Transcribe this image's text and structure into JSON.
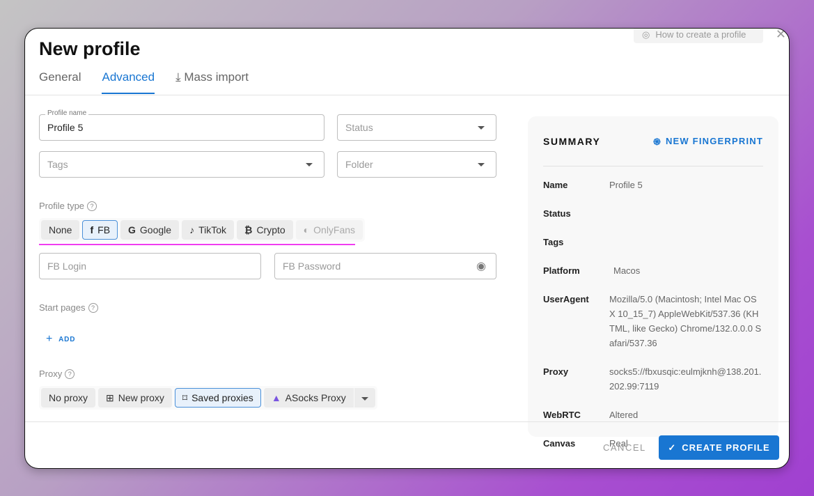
{
  "title": "New profile",
  "help_link": "How to create a profile",
  "tabs": [
    "General",
    "Advanced",
    "Mass import"
  ],
  "fields": {
    "profile_name_label": "Profile name",
    "profile_name": "Profile 5",
    "status": "Status",
    "tags": "Tags",
    "folder": "Folder",
    "fb_login": "FB Login",
    "fb_password": "FB Password"
  },
  "profile_type": {
    "label": "Profile type",
    "options": [
      "None",
      "FB",
      "Google",
      "TikTok",
      "Crypto",
      "OnlyFans"
    ],
    "selected": "FB"
  },
  "start_pages": {
    "label": "Start pages",
    "add": "ADD"
  },
  "proxy": {
    "label": "Proxy",
    "options": [
      "No proxy",
      "New proxy",
      "Saved proxies",
      "ASocks Proxy"
    ],
    "selected": "Saved proxies"
  },
  "summary": {
    "title": "SUMMARY",
    "new_fingerprint": "NEW FINGERPRINT",
    "rows": [
      {
        "k": "Name",
        "v": "Profile 5"
      },
      {
        "k": "Status",
        "v": ""
      },
      {
        "k": "Tags",
        "v": ""
      },
      {
        "k": "Platform",
        "v": "Macos"
      },
      {
        "k": "UserAgent",
        "v": "Mozilla/5.0 (Macintosh; Intel Mac OS X 10_15_7) AppleWebKit/537.36 (KHTML, like Gecko) Chrome/132.0.0.0 Safari/537.36"
      },
      {
        "k": "Proxy",
        "v": "socks5://fbxusqic:eulmjknh@138.201.202.99:7119"
      },
      {
        "k": "WebRTC",
        "v": "Altered"
      },
      {
        "k": "Canvas",
        "v": "Real"
      }
    ]
  },
  "footer": {
    "cancel": "CANCEL",
    "create": "CREATE PROFILE"
  },
  "colors": {
    "accent": "#1976d2",
    "highlight": "#f03cf0"
  }
}
